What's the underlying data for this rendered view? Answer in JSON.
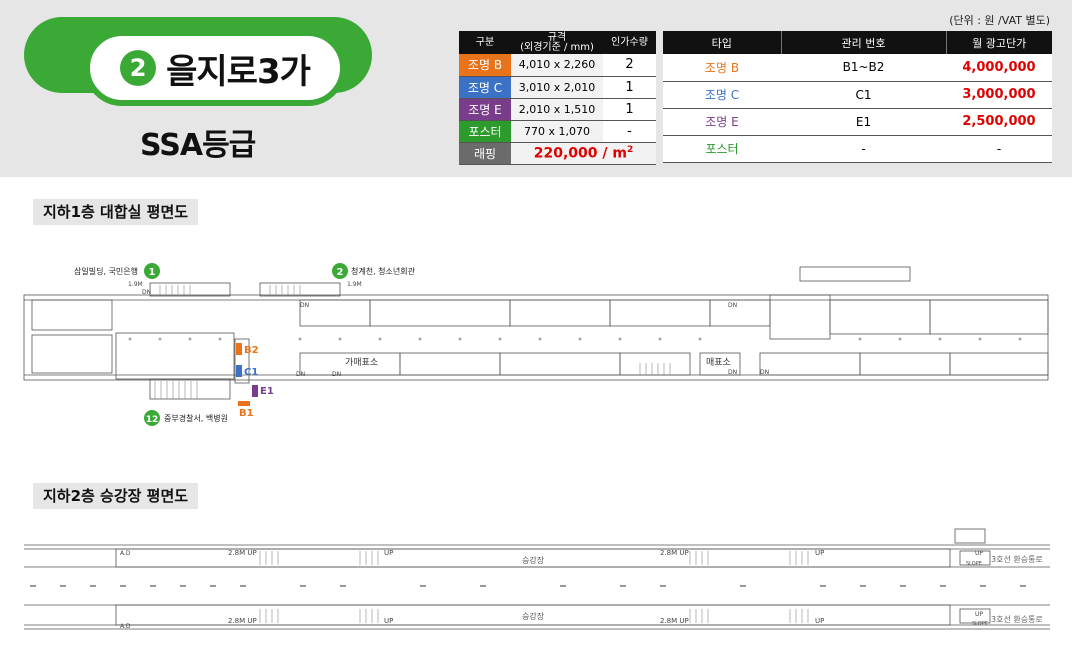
{
  "header": {
    "line_number": "2",
    "station_name": "을지로3가",
    "grade": "SSA등급",
    "unit_note": "(단위 : 원 /VAT 별도)"
  },
  "spec_table": {
    "headers": [
      "구분",
      "규격\n(외경기준 / mm)",
      "인가수량"
    ],
    "header_1": "구분",
    "header_2a": "규격",
    "header_2b": "(외경기준 / mm)",
    "header_3": "인가수량",
    "rows": [
      {
        "label": "조명 B",
        "size": "4,010 x 2,260",
        "qty": "2"
      },
      {
        "label": "조명 C",
        "size": "3,010 x 2,010",
        "qty": "1"
      },
      {
        "label": "조명 E",
        "size": "2,010 x 1,510",
        "qty": "1"
      },
      {
        "label": "포스터",
        "size": "770 x 1,070",
        "qty": "-"
      }
    ],
    "wrapping_label": "래핑",
    "wrapping_price": "220,000 / m",
    "wrapping_sup": "2"
  },
  "price_table": {
    "header_type": "타입",
    "header_code": "관리 번호",
    "header_price": "월 광고단가",
    "rows": [
      {
        "type": "조명 B",
        "code": "B1~B2",
        "price": "4,000,000"
      },
      {
        "type": "조명 C",
        "code": "C1",
        "price": "3,000,000"
      },
      {
        "type": "조명 E",
        "code": "E1",
        "price": "2,500,000"
      },
      {
        "type": "포스터",
        "code": "-",
        "price": "-"
      }
    ]
  },
  "colors": {
    "line_green": "#3aa935",
    "orange": "#e8731a",
    "blue": "#3b72c6",
    "purple": "#7a3d8c",
    "red": "#e00000"
  },
  "plan_b1": {
    "title": "지하1층 대합실 평면도",
    "exit1_num": "1",
    "exit1_label": "삼일빌딩, 국민은행",
    "exit2_num": "2",
    "exit2_label": "청계천, 청소년회관",
    "exit12_num": "12",
    "exit12_label": "중부경찰서, 백병원",
    "ticket_office": "가매표소",
    "ticket_office2": "매표소",
    "dim_1_9m": "1.9M",
    "dn": "DN",
    "markers": {
      "b2": "B2",
      "c1": "C1",
      "e1": "E1",
      "b1": "B1"
    }
  },
  "plan_b2": {
    "title": "지하2층 승강장 평면도",
    "platform": "승강장",
    "up_2_8m": "2.8M UP",
    "up": "UP",
    "transfer": "3호선 환승통로",
    "slope": "SLOPE",
    "ad": "A.D"
  }
}
